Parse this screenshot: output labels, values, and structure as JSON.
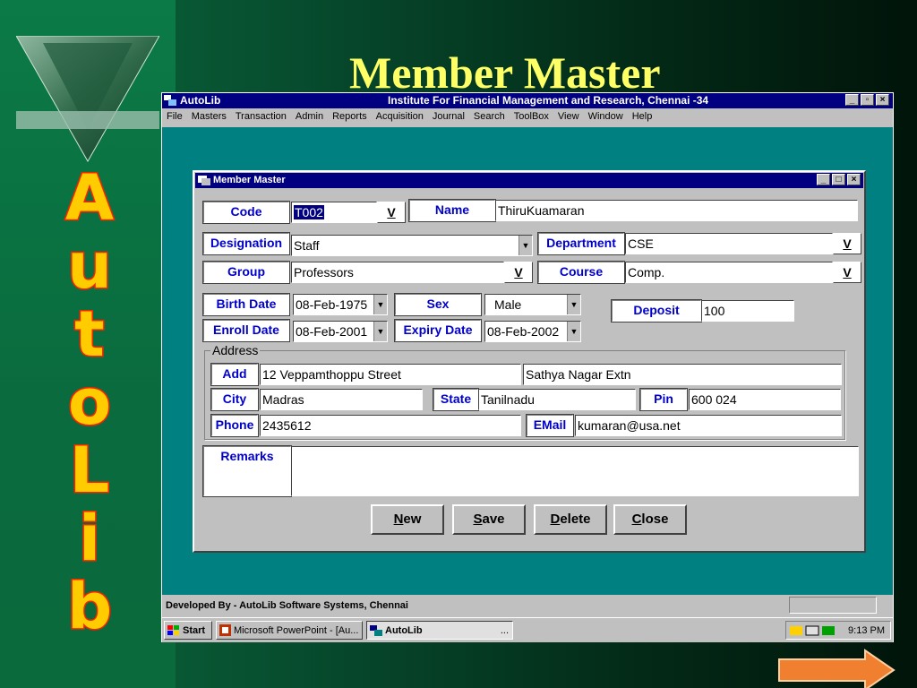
{
  "slide": {
    "title": "Member Master",
    "side_letters": [
      "A",
      "u",
      "t",
      "o",
      "L",
      "i",
      "b"
    ]
  },
  "app": {
    "title": "AutoLib",
    "subtitle": "Institute For Financial Management and Research, Chennai -34",
    "menu": [
      "File",
      "Masters",
      "Transaction",
      "Admin",
      "Reports",
      "Acquisition",
      "Journal",
      "Search",
      "ToolBox",
      "View",
      "Window",
      "Help"
    ],
    "status": "Developed By -  AutoLib Software Systems, Chennai"
  },
  "form": {
    "title": "Member Master",
    "labels": {
      "code": "Code",
      "name": "Name",
      "designation": "Designation",
      "department": "Department",
      "group": "Group",
      "course": "Course",
      "birth_date": "Birth Date",
      "sex": "Sex",
      "deposit": "Deposit",
      "enroll_date": "Enroll Date",
      "expiry_date": "Expiry Date",
      "address": "Address",
      "add": "Add",
      "city": "City",
      "state": "State",
      "pin": "Pin",
      "phone": "Phone",
      "email": "EMail",
      "remarks": "Remarks",
      "v": "V"
    },
    "values": {
      "code": "T002",
      "name": "ThiruKuamaran",
      "designation": "Staff",
      "department": "CSE",
      "group": "Professors",
      "course": "Comp.",
      "birth_date": "08-Feb-1975",
      "sex": "Male",
      "deposit": "100",
      "enroll_date": "08-Feb-2001",
      "expiry_date": "08-Feb-2002",
      "add1": "12 Veppamthoppu Street",
      "add2": "Sathya Nagar Extn",
      "city": "Madras",
      "state": "Tanilnadu",
      "pin": "600 024",
      "phone": "2435612",
      "email": "kumaran@usa.net",
      "remarks": ""
    },
    "buttons": {
      "new": {
        "key": "N",
        "rest": "ew"
      },
      "save": {
        "key": "S",
        "rest": "ave"
      },
      "delete": {
        "key": "D",
        "rest": "elete"
      },
      "close": {
        "key": "C",
        "rest": "lose"
      }
    }
  },
  "taskbar": {
    "start": "Start",
    "items": [
      "Microsoft PowerPoint - [Au...",
      "AutoLib",
      "..."
    ],
    "time": "9:13 PM"
  }
}
